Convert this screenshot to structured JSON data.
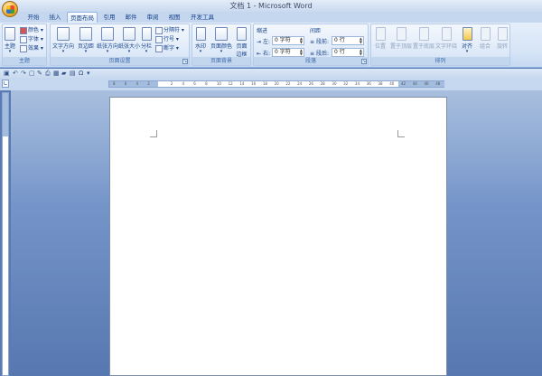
{
  "window": {
    "title": "文档 1 - Microsoft Word"
  },
  "tabs": [
    "开始",
    "插入",
    "页面布局",
    "引用",
    "邮件",
    "审阅",
    "视图",
    "开发工具"
  ],
  "active_tab": "页面布局",
  "ribbon": {
    "theme": {
      "label": "主题",
      "main": "主题",
      "colors": "颜色",
      "fonts": "字体",
      "effects": "效果"
    },
    "page_setup": {
      "label": "页面设置",
      "text_direction": "文字方向",
      "margins": "页边距",
      "orientation": "纸张方向",
      "size": "纸张大小",
      "columns": "分栏",
      "breaks": "分隔符",
      "line_numbers": "行号",
      "hyphenation": "断字"
    },
    "page_background": {
      "label": "页面背景",
      "watermark": "水印",
      "page_color": "页面颜色",
      "page_borders_line1": "页面",
      "page_borders_line2": "边框"
    },
    "paragraph": {
      "label": "段落",
      "indent": "缩进",
      "left": "左",
      "right": "右",
      "spacing": "间距",
      "before": "段前",
      "after": "段后",
      "indent_left_value": "0 字符",
      "indent_right_value": "0 字符",
      "spacing_before_value": "0 行",
      "spacing_after_value": "0 行"
    },
    "arrange": {
      "label": "排列",
      "position": "位置",
      "bring_front": "置于顶层",
      "send_back": "置于底层",
      "text_wrap": "文字环绕",
      "align": "对齐",
      "group": "组合",
      "rotate": "旋转"
    }
  },
  "ruler": {
    "ticks": [
      "8",
      "6",
      "4",
      "2",
      "",
      "2",
      "4",
      "6",
      "8",
      "10",
      "12",
      "14",
      "16",
      "18",
      "20",
      "22",
      "24",
      "26",
      "28",
      "30",
      "32",
      "34",
      "36",
      "38",
      "40",
      "42",
      "44",
      "46",
      "48"
    ]
  },
  "colors": {
    "ribbon_bg": "#d4e3f6",
    "doc_bg": "#7595c9",
    "page": "#ffffff"
  }
}
